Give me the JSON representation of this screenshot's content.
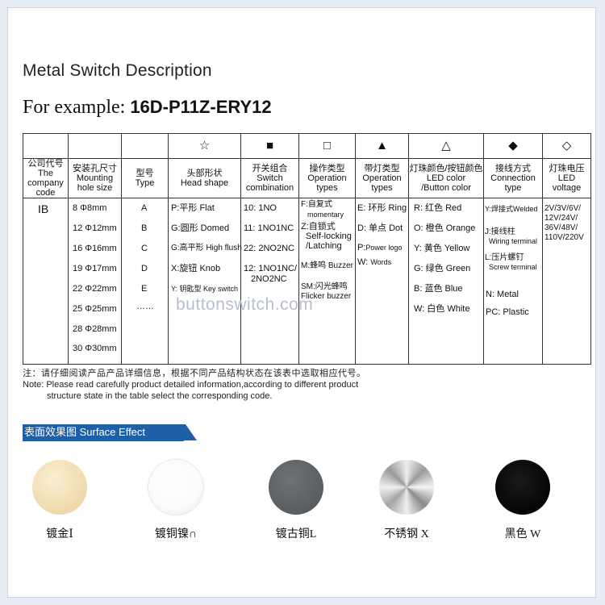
{
  "title": "Metal Switch Description",
  "example": {
    "prefix": "For example:",
    "code": "16D-P11Z-ERY12"
  },
  "symbols": [
    "☆",
    "■",
    "□",
    "▲",
    "△",
    "◆",
    "◇"
  ],
  "headers": [
    {
      "cn": "公司代号",
      "en1": "The",
      "en2": "company",
      "en3": "code"
    },
    {
      "cn": "安装孔尺寸",
      "en1": "Mounting",
      "en2": "hole size"
    },
    {
      "cn": "型号",
      "en1": "Type"
    },
    {
      "cn": "头部形状",
      "en1": "Head shape"
    },
    {
      "cn": "开关组合",
      "en1": "Switch",
      "en2": "combination"
    },
    {
      "cn": "操作类型",
      "en1": "Operation",
      "en2": "types"
    },
    {
      "cn": "带灯类型",
      "en1": "Operation",
      "en2": "types"
    },
    {
      "cn": "灯珠颜色/按钮颜色",
      "en1": "LED color",
      "en2": "/Button color"
    },
    {
      "cn": "接线方式",
      "en1": "Connection",
      "en2": "type"
    },
    {
      "cn": "灯珠电压",
      "en1": "LED voltage"
    }
  ],
  "company_code": "IB",
  "hole_sizes": [
    "8   Φ8mm",
    "12 Φ12mm",
    "16 Φ16mm",
    "19 Φ17mm",
    "22 Φ22mm",
    "25 Φ25mm",
    "28 Φ28mm",
    "30 Φ30mm"
  ],
  "types": [
    "A",
    "B",
    "C",
    "D",
    "E",
    "……"
  ],
  "head_shapes": [
    "P:平形 Flat",
    "G:圆形 Domed",
    "G:高平形 High flush",
    "X:旋钮 Knob",
    "Y: 钥匙型 Key switch"
  ],
  "switch_combos": [
    "10: 1NO",
    "11: 1NO1NC",
    "22: 2NO2NC",
    "12: 1NO1NC/",
    "2NO2NC"
  ],
  "operation": {
    "f1": "F:自复式",
    "f2": "momentary",
    "z1": "Z:自锁式",
    "z2": "Self-locking",
    "z3": "/Latching",
    "m": "M:蜂鸣 Buzzer",
    "sm1": "SM:闪光蜂鸣",
    "sm2": "Flicker buzzer"
  },
  "lamp_types": {
    "e": "E: 环形 Ring",
    "d": "D: 单点 Dot",
    "p1": "P:",
    "p2": "Power logo",
    "w1": "W:",
    "w2": "Words"
  },
  "led_colors": [
    "R: 红色 Red",
    "O: 橙色 Orange",
    "Y: 黄色 Yellow",
    "G: 绿色 Green",
    "B: 蓝色 Blue",
    "W: 白色 White"
  ],
  "connection": {
    "y": "Y:焊接式Welded",
    "j1": "J:接线柱",
    "j2": "Wiring terminal",
    "l1": "L:压片螺钉",
    "l2": "Screw terminal",
    "n": "N: Metal",
    "pc": "PC: Plastic"
  },
  "voltages": [
    "2V/3V/6V/",
    "12V/24V/",
    "36V/48V/",
    "110V/220V"
  ],
  "watermark": "buttonswitch.com",
  "note": {
    "cn": "注：请仔细阅读产品产品详细信息，根据不同产品结构状态在该表中选取相应代号。",
    "en1": "Note: Please read carefully product detailed information,according to different product",
    "en2": "structure state in the table select the corresponding code."
  },
  "surface": {
    "title": "表面效果图 Surface Effect",
    "items": [
      {
        "label": "镀金Ⅰ",
        "color": "#f2dfb4"
      },
      {
        "label": "镀铜镍∩",
        "color": "#ffffff"
      },
      {
        "label": "镀古铜L",
        "color": "#606468"
      },
      {
        "label": "不锈钢 X",
        "color": "#c8c8c8"
      },
      {
        "label": "黑色 W",
        "color": "#0a0a0a"
      }
    ]
  }
}
